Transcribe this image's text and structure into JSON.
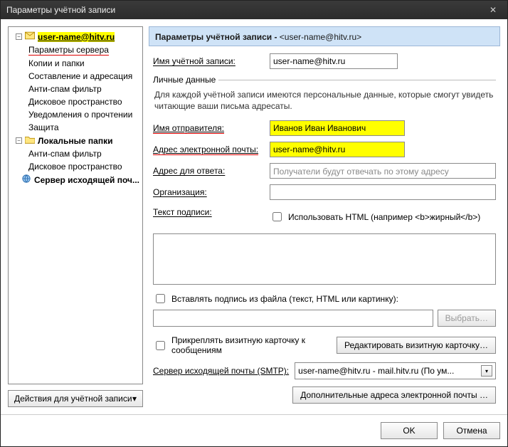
{
  "window": {
    "title": "Параметры учётной записи"
  },
  "sidebar": {
    "account": {
      "label": "user-name@hitv.ru",
      "items": [
        "Параметры сервера",
        "Копии и папки",
        "Составление и адресация",
        "Анти-спам фильтр",
        "Дисковое пространство",
        "Уведомления о прочтении",
        "Защита"
      ]
    },
    "local": {
      "label": "Локальные папки",
      "items": [
        "Анти-спам фильтр",
        "Дисковое пространство"
      ]
    },
    "smtp": "Сервер исходящей поч...",
    "actions_button": "Действия для учётной записи"
  },
  "panel": {
    "title_prefix": "Параметры учётной записи - ",
    "title_email": "<user-name@hitv.ru>",
    "account_name_label": "Имя учётной записи:",
    "account_name_value": "user-name@hitv.ru",
    "personal_section": "Личные данные",
    "personal_desc": "Для каждой учётной записи имеются персональные данные, которые смогут увидеть читающие ваши письма адресаты.",
    "sender_name_label": "Имя отправителя:",
    "sender_name_value": "Иванов Иван Иванович",
    "email_label": "Адрес электронной почты:",
    "email_value": "user-name@hitv.ru",
    "reply_label": "Адрес для ответа:",
    "reply_placeholder": "Получатели будут отвечать по этому адресу",
    "org_label": "Организация:",
    "sig_text_label": "Текст подписи:",
    "sig_html_chk": "Использовать HTML (например <b>жирный</b>)",
    "sig_file_chk": "Вставлять подпись из файла (текст, HTML или картинку):",
    "browse_btn": "Выбрать…",
    "vcard_chk": "Прикреплять визитную карточку к сообщениям",
    "vcard_btn": "Редактировать визитную карточку…",
    "smtp_label": "Сервер исходящей почты (SMTP):",
    "smtp_value": "user-name@hitv.ru - mail.hitv.ru       (По ум...",
    "extra_addr_btn": "Дополнительные адреса электронной почты …"
  },
  "footer": {
    "ok": "OK",
    "cancel": "Отмена"
  }
}
